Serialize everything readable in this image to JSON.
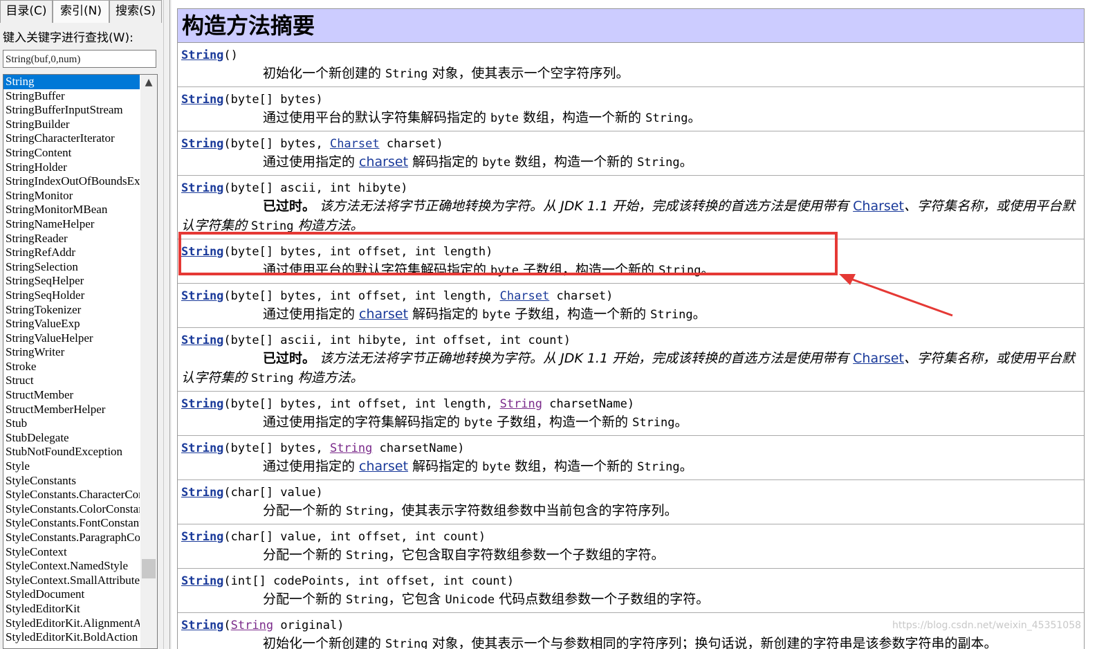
{
  "tabs": [
    "目录(C)",
    "索引(N)",
    "搜索(S)"
  ],
  "prompt": "键入关键字进行查找(W):",
  "keyword": "String(buf,0,num)",
  "class_list": [
    "String",
    "StringBuffer",
    "StringBufferInputStream",
    "StringBuilder",
    "StringCharacterIterator",
    "StringContent",
    "StringHolder",
    "StringIndexOutOfBoundsException",
    "StringMonitor",
    "StringMonitorMBean",
    "StringNameHelper",
    "StringReader",
    "StringRefAddr",
    "StringSelection",
    "StringSeqHelper",
    "StringSeqHolder",
    "StringTokenizer",
    "StringValueExp",
    "StringValueHelper",
    "StringWriter",
    "Stroke",
    "Struct",
    "StructMember",
    "StructMemberHelper",
    "Stub",
    "StubDelegate",
    "StubNotFoundException",
    "Style",
    "StyleConstants",
    "StyleConstants.CharacterConstants",
    "StyleConstants.ColorConstants",
    "StyleConstants.FontConstants",
    "StyleConstants.ParagraphConstants",
    "StyleContext",
    "StyleContext.NamedStyle",
    "StyleContext.SmallAttributeSet",
    "StyledDocument",
    "StyledEditorKit",
    "StyledEditorKit.AlignmentAction",
    "StyledEditorKit.BoldAction"
  ],
  "selected_index": 0,
  "heading": "构造方法摘要",
  "method": "String",
  "rows": [
    {
      "sig": [
        [
          "t",
          "()"
        ]
      ],
      "desc": [
        [
          "t",
          "初始化一个新创建的 "
        ],
        [
          "c",
          "String"
        ],
        [
          "t",
          " 对象，使其表示一个空字符序列。"
        ]
      ]
    },
    {
      "sig": [
        [
          "t",
          "(byte[] bytes)"
        ]
      ],
      "desc": [
        [
          "t",
          "通过使用平台的默认字符集解码指定的 "
        ],
        [
          "c",
          "byte"
        ],
        [
          "t",
          " 数组，构造一个新的 "
        ],
        [
          "c",
          "String"
        ],
        [
          "t",
          "。"
        ]
      ]
    },
    {
      "sig": [
        [
          "t",
          "(byte[] bytes, "
        ],
        [
          "l",
          "Charset"
        ],
        [
          "t",
          " charset)"
        ]
      ],
      "desc": [
        [
          "t",
          "通过使用指定的 "
        ],
        [
          "l",
          "charset"
        ],
        [
          "t",
          " 解码指定的 "
        ],
        [
          "c",
          "byte"
        ],
        [
          "t",
          " 数组，构造一个新的 "
        ],
        [
          "c",
          "String"
        ],
        [
          "t",
          "。"
        ]
      ]
    },
    {
      "sig": [
        [
          "t",
          "(byte[] ascii, int hibyte)"
        ]
      ],
      "wrap": true,
      "desc": [
        [
          "b",
          "已过时。"
        ],
        [
          "i",
          " 该方法无法将字节正确地转换为字符。从 JDK 1.1 开始，完成该转换的首选方法是使用带有 "
        ],
        [
          "l",
          "Charset"
        ],
        [
          "i",
          "、字符集名称，或使用平台默认字符集的 "
        ],
        [
          "c",
          "String"
        ],
        [
          "i",
          " 构造方法。"
        ]
      ]
    },
    {
      "sig": [
        [
          "t",
          "(byte[] bytes, int offset, int length)"
        ]
      ],
      "desc": [
        [
          "t",
          "通过使用平台的默认字符集解码指定的 "
        ],
        [
          "c",
          "byte"
        ],
        [
          "t",
          " 子数组，构造一个新的 "
        ],
        [
          "c",
          "String"
        ],
        [
          "t",
          "。"
        ]
      ]
    },
    {
      "sig": [
        [
          "t",
          "(byte[] bytes, int offset, int length, "
        ],
        [
          "l",
          "Charset"
        ],
        [
          "t",
          " charset)"
        ]
      ],
      "desc": [
        [
          "t",
          "通过使用指定的 "
        ],
        [
          "l",
          "charset"
        ],
        [
          "t",
          " 解码指定的 "
        ],
        [
          "c",
          "byte"
        ],
        [
          "t",
          " 子数组，构造一个新的 "
        ],
        [
          "c",
          "String"
        ],
        [
          "t",
          "。"
        ]
      ]
    },
    {
      "sig": [
        [
          "t",
          "(byte[] ascii, int hibyte, int offset, int count)"
        ]
      ],
      "wrap": true,
      "desc": [
        [
          "b",
          "已过时。"
        ],
        [
          "i",
          " 该方法无法将字节正确地转换为字符。从 JDK 1.1 开始，完成该转换的首选方法是使用带有 "
        ],
        [
          "l",
          "Charset"
        ],
        [
          "i",
          "、字符集名称，或使用平台默认字符集的 "
        ],
        [
          "c",
          "String"
        ],
        [
          "i",
          " 构造方法。"
        ]
      ]
    },
    {
      "sig": [
        [
          "t",
          "(byte[] bytes, int offset, int length, "
        ],
        [
          "v",
          "String"
        ],
        [
          "t",
          " charsetName)"
        ]
      ],
      "desc": [
        [
          "t",
          "通过使用指定的字符集解码指定的 "
        ],
        [
          "c",
          "byte"
        ],
        [
          "t",
          " 子数组，构造一个新的 "
        ],
        [
          "c",
          "String"
        ],
        [
          "t",
          "。"
        ]
      ]
    },
    {
      "sig": [
        [
          "t",
          "(byte[] bytes, "
        ],
        [
          "v",
          "String"
        ],
        [
          "t",
          " charsetName)"
        ]
      ],
      "desc": [
        [
          "t",
          "通过使用指定的 "
        ],
        [
          "l",
          "charset"
        ],
        [
          "t",
          " 解码指定的 "
        ],
        [
          "c",
          "byte"
        ],
        [
          "t",
          " 数组，构造一个新的 "
        ],
        [
          "c",
          "String"
        ],
        [
          "t",
          "。"
        ]
      ]
    },
    {
      "sig": [
        [
          "t",
          "(char[] value)"
        ]
      ],
      "desc": [
        [
          "t",
          "分配一个新的 "
        ],
        [
          "c",
          "String"
        ],
        [
          "t",
          "，使其表示字符数组参数中当前包含的字符序列。"
        ]
      ]
    },
    {
      "sig": [
        [
          "t",
          "(char[] value, int offset, int count)"
        ]
      ],
      "desc": [
        [
          "t",
          "分配一个新的 "
        ],
        [
          "c",
          "String"
        ],
        [
          "t",
          "，它包含取自字符数组参数一个子数组的字符。"
        ]
      ]
    },
    {
      "sig": [
        [
          "t",
          "(int[] codePoints, int offset, int count)"
        ]
      ],
      "desc": [
        [
          "t",
          "分配一个新的 "
        ],
        [
          "c",
          "String"
        ],
        [
          "t",
          "，它包含 "
        ],
        [
          "c",
          "Unicode"
        ],
        [
          "t",
          " 代码点数组参数一个子数组的字符。"
        ]
      ]
    },
    {
      "sig": [
        [
          "t",
          "("
        ],
        [
          "v",
          "String"
        ],
        [
          "t",
          " original)"
        ]
      ],
      "wrap": true,
      "desc": [
        [
          "t",
          "初始化一个新创建的 "
        ],
        [
          "c",
          "String"
        ],
        [
          "t",
          " 对象，使其表示一个与参数相同的字符序列；换句话说，新创建的字符串是该参数字符串的副本。"
        ]
      ]
    }
  ],
  "highlighted_row": 4,
  "watermark": "https://blog.csdn.net/weixin_45351058",
  "colors": {
    "accent": "#e53935",
    "heading_bg": "#ccccff",
    "link": "#1a3a9a",
    "selection": "#0078d7"
  }
}
